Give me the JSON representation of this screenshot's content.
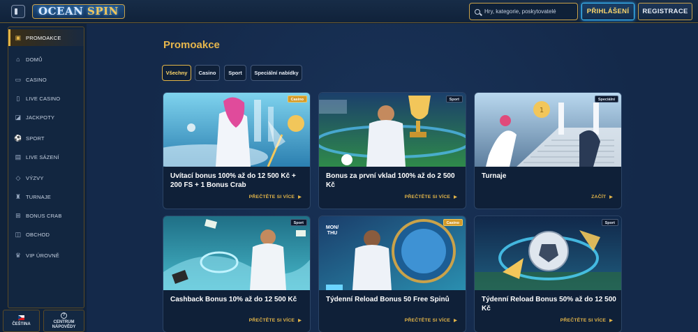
{
  "header": {
    "logo_text": "OCEAN",
    "logo_text2": "SPIN",
    "search_placeholder": "Hry, kategorie, poskytovatelé",
    "login_label": "PŘIHLÁŠENÍ",
    "register_label": "REGISTRACE"
  },
  "sidebar": {
    "items": [
      {
        "label": "PROMOAKCE",
        "icon": "gift-icon",
        "active": true
      },
      {
        "label": "DOMŮ",
        "icon": "home-icon"
      },
      {
        "label": "CASINO",
        "icon": "casino-icon"
      },
      {
        "label": "LIVE CASINO",
        "icon": "live-casino-icon"
      },
      {
        "label": "JACKPOTY",
        "icon": "jackpot-icon"
      },
      {
        "label": "SPORT",
        "icon": "sport-icon"
      },
      {
        "label": "LIVE SÁZENÍ",
        "icon": "live-betting-icon"
      },
      {
        "label": "VÝZVY",
        "icon": "challenges-icon"
      },
      {
        "label": "TURNAJE",
        "icon": "tournament-icon"
      },
      {
        "label": "BONUS CRAB",
        "icon": "crab-icon"
      },
      {
        "label": "OBCHOD",
        "icon": "shop-icon"
      },
      {
        "label": "VIP ÚROVNĚ",
        "icon": "vip-icon"
      }
    ],
    "language_label": "ČEŠTINA",
    "help_label_1": "CENTRUM",
    "help_label_2": "NÁPOVĚDY"
  },
  "main": {
    "title": "Promoakce",
    "filters": [
      {
        "label": "Všechny",
        "active": true
      },
      {
        "label": "Casino"
      },
      {
        "label": "Sport"
      },
      {
        "label": "Speciální nabídky"
      }
    ],
    "cards": [
      {
        "title": "Uvítací bonus 100% až do 12 500 Kč + 200 FS + 1 Bonus Crab",
        "tag": "Casino",
        "link": "PŘEČTĚTE SI VÍCE"
      },
      {
        "title": "Bonus za první vklad 100% až do 2 500 Kč",
        "tag": "Sport",
        "link": "PŘEČTĚTE SI VÍCE"
      },
      {
        "title": "Turnaje",
        "tag": "Speciální",
        "link": "ZAČÍT"
      },
      {
        "title": "Cashback Bonus 10% až do 12 500 Kč",
        "tag": "Sport",
        "link": "PŘEČTĚTE SI VÍCE"
      },
      {
        "title": "Týdenní Reload Bonus 50 Free Spinů",
        "tag": "Casino",
        "link": "PŘEČTĚTE SI VÍCE",
        "badge": "MON/ THU"
      },
      {
        "title": "Týdenní Reload Bonus 50% až do 12 500 Kč",
        "tag": "Sport",
        "link": "PŘEČTĚTE SI VÍCE"
      }
    ]
  },
  "colors": {
    "accent_gold": "#e3b548",
    "background": "#14294a",
    "login_border": "#3fc5ff"
  }
}
